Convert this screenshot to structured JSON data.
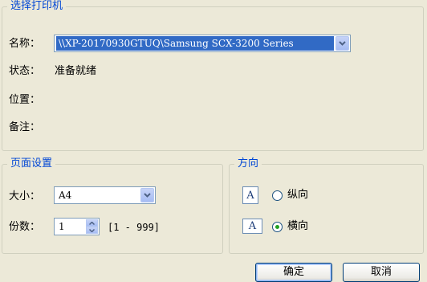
{
  "printer_group": {
    "legend": "选择打印机",
    "name_label": "名称：",
    "name_value": "\\\\XP-20170930GTUQ\\Samsung SCX-3200 Series",
    "status_label": "状态：",
    "status_value": "准备就绪",
    "location_label": "位置：",
    "comment_label": "备注："
  },
  "page_setup": {
    "legend": "页面设置",
    "size_label": "大小：",
    "size_value": "A4",
    "copies_label": "份数：",
    "copies_value": "1",
    "copies_range": "[1 - 999]"
  },
  "orientation": {
    "legend": "方向",
    "icon_letter": "A",
    "portrait_label": "纵向",
    "landscape_label": "横向",
    "selected": "landscape"
  },
  "buttons": {
    "ok": "确定",
    "cancel": "取消"
  }
}
